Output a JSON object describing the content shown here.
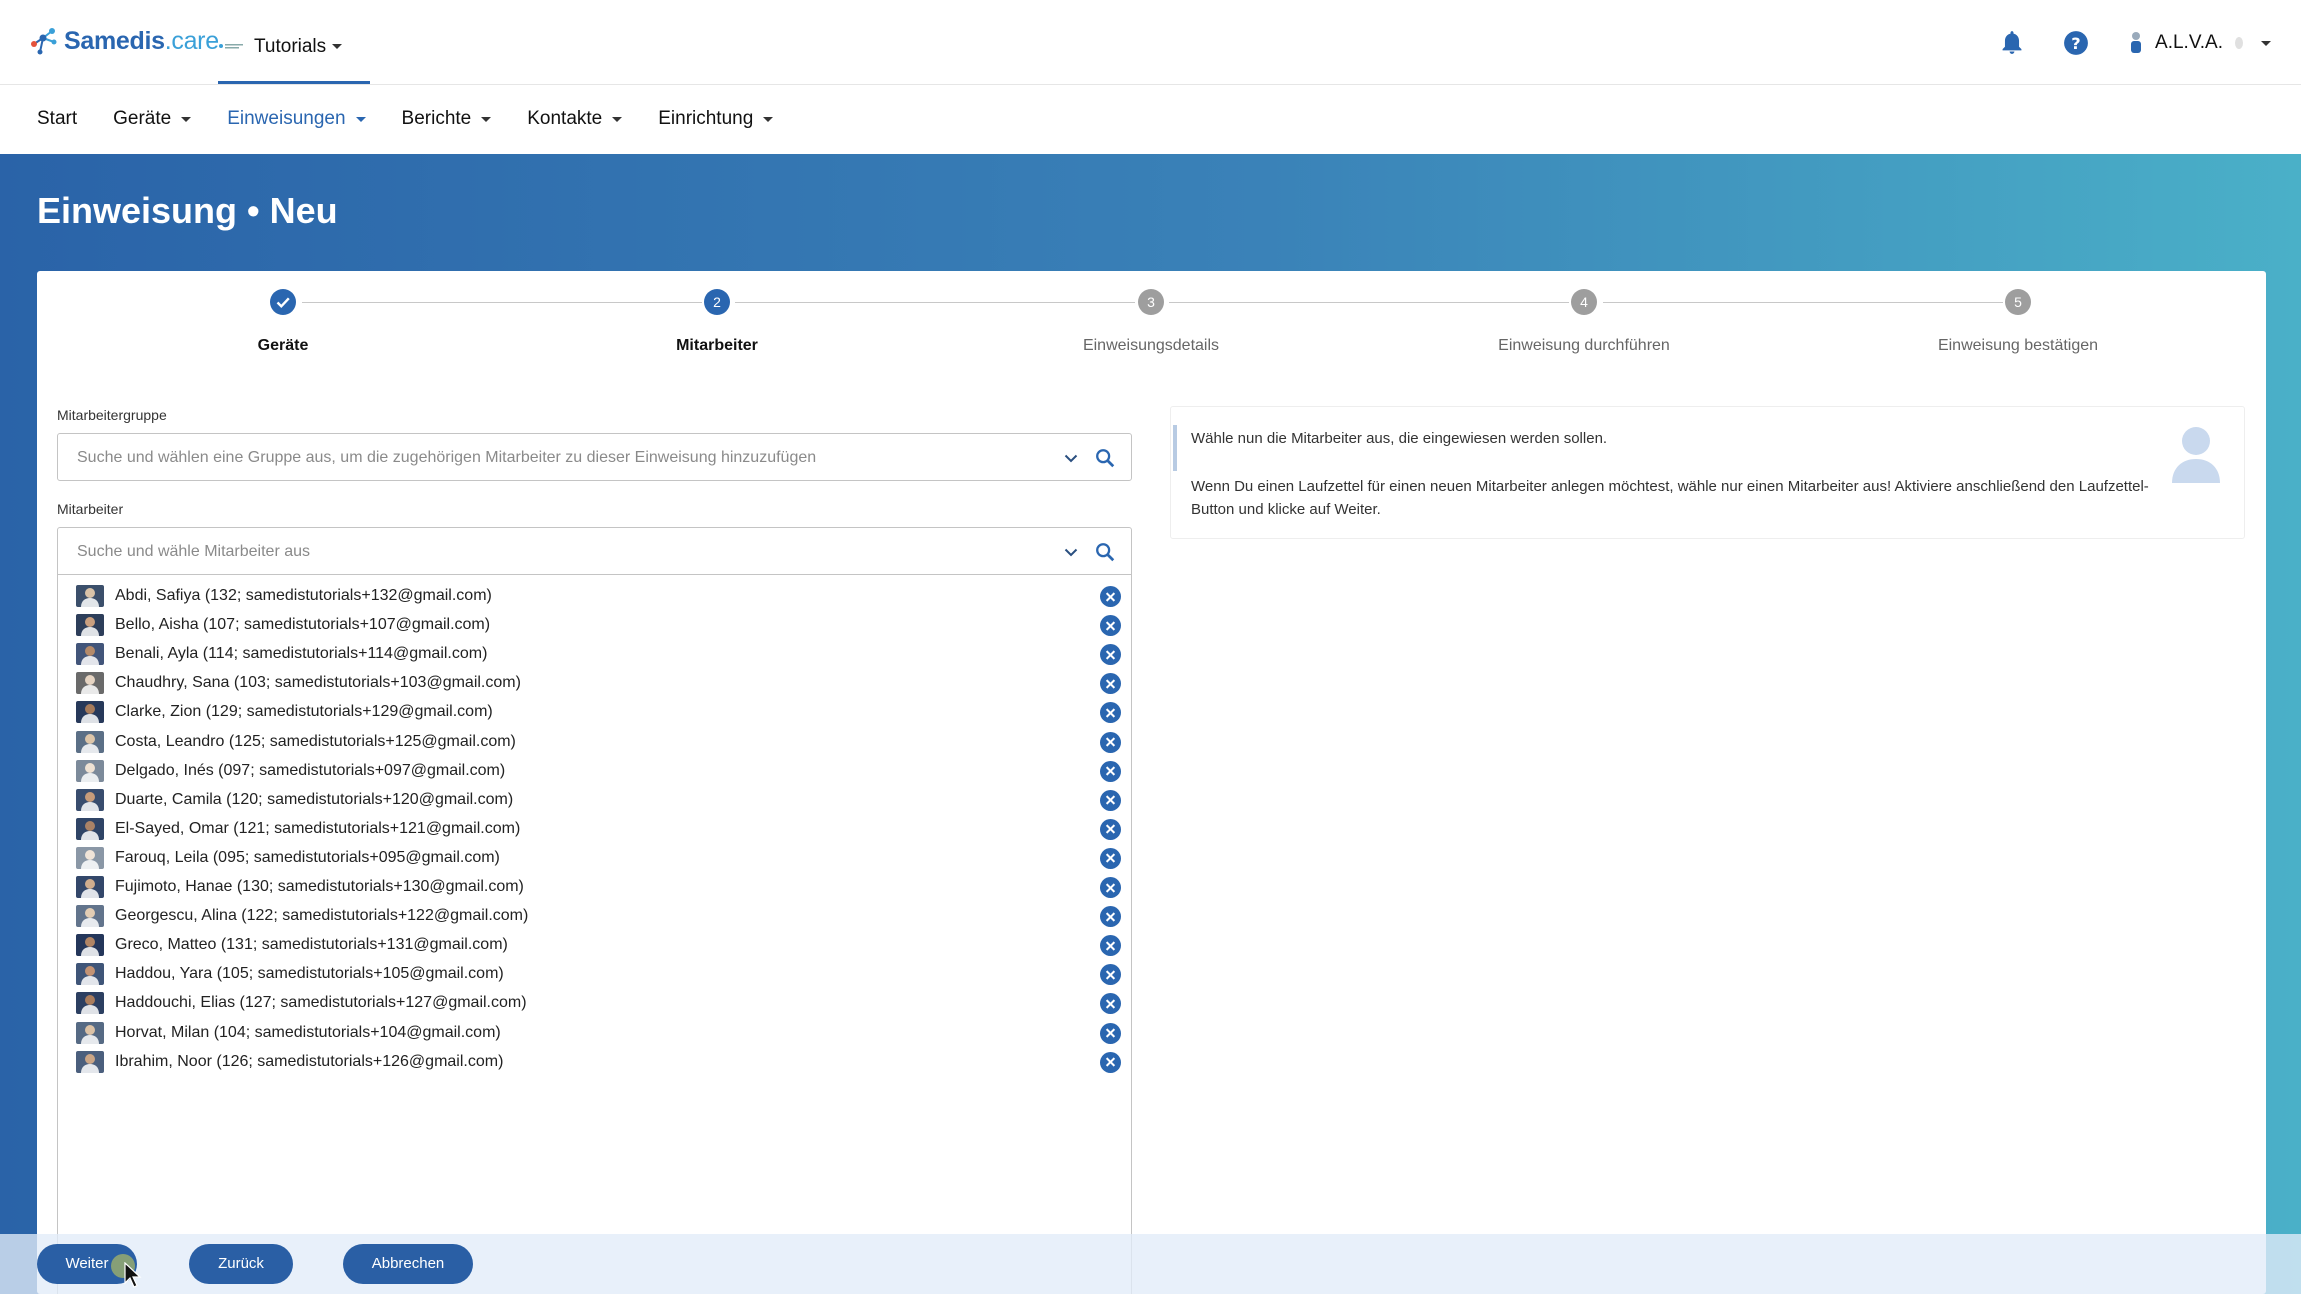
{
  "header": {
    "brand": "Samedis",
    "brand_suffix": ".care",
    "tenant": "Tutorials",
    "user": "A.L.V.A.",
    "icons": {
      "notifications": "bell-icon",
      "help": "help-icon"
    }
  },
  "menu": {
    "items": [
      "Start",
      "Geräte",
      "Einweisungen",
      "Berichte",
      "Kontakte",
      "Einrichtung"
    ],
    "active": "Einweisungen"
  },
  "page": {
    "title": "Einweisung • Neu"
  },
  "stepper": {
    "steps": [
      {
        "number": "✓",
        "label": "Geräte",
        "state": "done"
      },
      {
        "number": "2",
        "label": "Mitarbeiter",
        "state": "current"
      },
      {
        "number": "3",
        "label": "Einweisungsdetails",
        "state": "todo"
      },
      {
        "number": "4",
        "label": "Einweisung durchführen",
        "state": "todo"
      },
      {
        "number": "5",
        "label": "Einweisung bestätigen",
        "state": "todo"
      }
    ]
  },
  "form": {
    "group_label": "Mitarbeitergruppe",
    "group_placeholder": "Suche und wählen eine Gruppe aus, um die zugehörigen Mitarbeiter zu dieser Einweisung hinzuzufügen",
    "employee_label": "Mitarbeiter",
    "employee_placeholder": "Suche und wähle Mitarbeiter aus"
  },
  "employees": [
    "Abdi, Safiya (132; samedistutorials+132@gmail.com)",
    "Bello, Aisha (107; samedistutorials+107@gmail.com)",
    "Benali, Ayla (114; samedistutorials+114@gmail.com)",
    "Chaudhry, Sana (103; samedistutorials+103@gmail.com)",
    "Clarke, Zion (129; samedistutorials+129@gmail.com)",
    "Costa, Leandro (125; samedistutorials+125@gmail.com)",
    "Delgado, Inés (097; samedistutorials+097@gmail.com)",
    "Duarte, Camila (120; samedistutorials+120@gmail.com)",
    "El-Sayed, Omar (121; samedistutorials+121@gmail.com)",
    "Farouq, Leila (095; samedistutorials+095@gmail.com)",
    "Fujimoto, Hanae (130; samedistutorials+130@gmail.com)",
    "Georgescu, Alina (122; samedistutorials+122@gmail.com)",
    "Greco, Matteo (131; samedistutorials+131@gmail.com)",
    "Haddou, Yara (105; samedistutorials+105@gmail.com)",
    "Haddouchi, Elias (127; samedistutorials+127@gmail.com)",
    "Horvat, Milan (104; samedistutorials+104@gmail.com)",
    "Ibrahim, Noor (126; samedistutorials+126@gmail.com)"
  ],
  "info": {
    "line1": "Wähle nun die Mitarbeiter aus, die eingewiesen werden sollen.",
    "line2": "Wenn Du einen Laufzettel für einen neuen Mitarbeiter anlegen möchtest, wähle nur einen Mitarbeiter aus! Aktiviere anschließend den Laufzettel-Button und klicke auf Weiter."
  },
  "actions": {
    "next": "Weiter",
    "back": "Zurück",
    "cancel": "Abbrechen"
  },
  "colors": {
    "primary": "#2a66b0",
    "hero_start": "#2a63a8",
    "hero_end": "#4ab0c8"
  }
}
